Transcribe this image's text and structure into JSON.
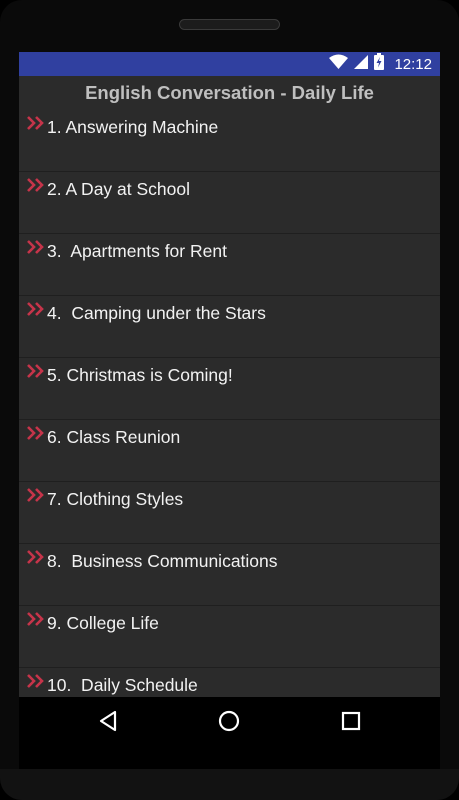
{
  "status_bar": {
    "time": "12:12",
    "icons": [
      "wifi-icon",
      "cell-signal-icon",
      "battery-charging-icon"
    ],
    "background_color": "#3040a0"
  },
  "app": {
    "title": "English Conversation - Daily Life"
  },
  "list": {
    "chevron_color": "#c6344a",
    "items": [
      {
        "label": "1. Answering Machine"
      },
      {
        "label": "2. A Day at School"
      },
      {
        "label": "3.  Apartments for Rent"
      },
      {
        "label": "4.  Camping under the Stars"
      },
      {
        "label": "5. Christmas is Coming!"
      },
      {
        "label": "6. Class Reunion"
      },
      {
        "label": "7. Clothing Styles"
      },
      {
        "label": "8.  Business Communications"
      },
      {
        "label": "9. College Life"
      },
      {
        "label": "10.  Daily Schedule"
      }
    ]
  },
  "nav_bar": {
    "buttons": [
      "back-icon",
      "home-icon",
      "recents-icon"
    ]
  }
}
